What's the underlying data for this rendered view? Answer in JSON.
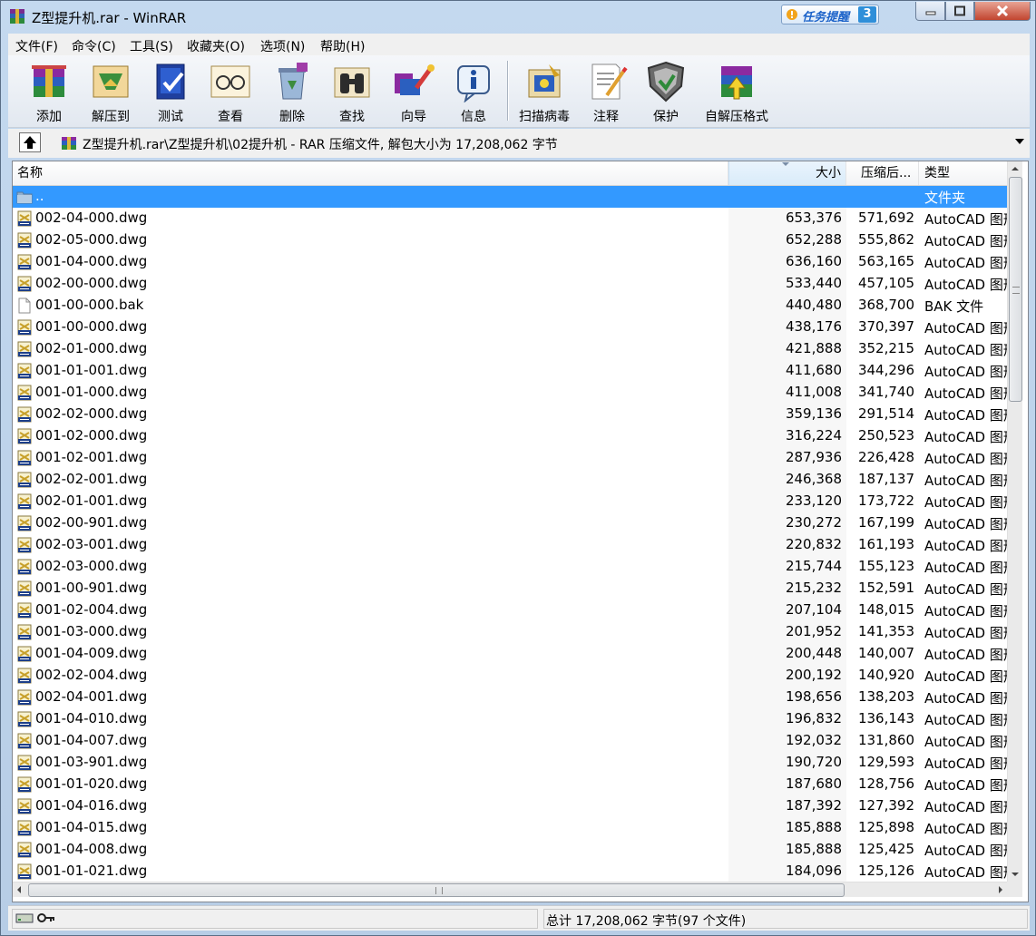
{
  "window": {
    "title": "Z型提升机.rar - WinRAR",
    "tip_text": "任务提醒",
    "tip_count": "3"
  },
  "menu": [
    "文件(F)",
    "命令(C)",
    "工具(S)",
    "收藏夹(O)",
    "选项(N)",
    "帮助(H)"
  ],
  "toolbar": {
    "add": "添加",
    "extract": "解压到",
    "test": "测试",
    "view": "查看",
    "delete": "删除",
    "find": "查找",
    "wizard": "向导",
    "info": "信息",
    "scan": "扫描病毒",
    "comment": "注释",
    "protect": "保护",
    "sfx": "自解压格式"
  },
  "address": {
    "path": "Z型提升机.rar\\Z型提升机\\02提升机 - RAR 压缩文件, 解包大小为 17,208,062 字节"
  },
  "columns": {
    "name": "名称",
    "size": "大小",
    "packed": "压缩后...",
    "type": "类型"
  },
  "files": [
    {
      "name": "..",
      "size": "",
      "packed": "",
      "type": "文件夹",
      "icon": "folder-up-icon"
    },
    {
      "name": "002-04-000.dwg",
      "size": "653,376",
      "packed": "571,692",
      "type": "AutoCAD 图形",
      "icon": "dwg-file-icon"
    },
    {
      "name": "002-05-000.dwg",
      "size": "652,288",
      "packed": "555,862",
      "type": "AutoCAD 图形",
      "icon": "dwg-file-icon"
    },
    {
      "name": "001-04-000.dwg",
      "size": "636,160",
      "packed": "563,165",
      "type": "AutoCAD 图形",
      "icon": "dwg-file-icon"
    },
    {
      "name": "002-00-000.dwg",
      "size": "533,440",
      "packed": "457,105",
      "type": "AutoCAD 图形",
      "icon": "dwg-file-icon"
    },
    {
      "name": "001-00-000.bak",
      "size": "440,480",
      "packed": "368,700",
      "type": "BAK 文件",
      "icon": "blank-file-icon"
    },
    {
      "name": "001-00-000.dwg",
      "size": "438,176",
      "packed": "370,397",
      "type": "AutoCAD 图形",
      "icon": "dwg-file-icon"
    },
    {
      "name": "002-01-000.dwg",
      "size": "421,888",
      "packed": "352,215",
      "type": "AutoCAD 图形",
      "icon": "dwg-file-icon"
    },
    {
      "name": "001-01-001.dwg",
      "size": "411,680",
      "packed": "344,296",
      "type": "AutoCAD 图形",
      "icon": "dwg-file-icon"
    },
    {
      "name": "001-01-000.dwg",
      "size": "411,008",
      "packed": "341,740",
      "type": "AutoCAD 图形",
      "icon": "dwg-file-icon"
    },
    {
      "name": "002-02-000.dwg",
      "size": "359,136",
      "packed": "291,514",
      "type": "AutoCAD 图形",
      "icon": "dwg-file-icon"
    },
    {
      "name": "001-02-000.dwg",
      "size": "316,224",
      "packed": "250,523",
      "type": "AutoCAD 图形",
      "icon": "dwg-file-icon"
    },
    {
      "name": "001-02-001.dwg",
      "size": "287,936",
      "packed": "226,428",
      "type": "AutoCAD 图形",
      "icon": "dwg-file-icon"
    },
    {
      "name": "002-02-001.dwg",
      "size": "246,368",
      "packed": "187,137",
      "type": "AutoCAD 图形",
      "icon": "dwg-file-icon"
    },
    {
      "name": "002-01-001.dwg",
      "size": "233,120",
      "packed": "173,722",
      "type": "AutoCAD 图形",
      "icon": "dwg-file-icon"
    },
    {
      "name": "002-00-901.dwg",
      "size": "230,272",
      "packed": "167,199",
      "type": "AutoCAD 图形",
      "icon": "dwg-file-icon"
    },
    {
      "name": "002-03-001.dwg",
      "size": "220,832",
      "packed": "161,193",
      "type": "AutoCAD 图形",
      "icon": "dwg-file-icon"
    },
    {
      "name": "002-03-000.dwg",
      "size": "215,744",
      "packed": "155,123",
      "type": "AutoCAD 图形",
      "icon": "dwg-file-icon"
    },
    {
      "name": "001-00-901.dwg",
      "size": "215,232",
      "packed": "152,591",
      "type": "AutoCAD 图形",
      "icon": "dwg-file-icon"
    },
    {
      "name": "001-02-004.dwg",
      "size": "207,104",
      "packed": "148,015",
      "type": "AutoCAD 图形",
      "icon": "dwg-file-icon"
    },
    {
      "name": "001-03-000.dwg",
      "size": "201,952",
      "packed": "141,353",
      "type": "AutoCAD 图形",
      "icon": "dwg-file-icon"
    },
    {
      "name": "001-04-009.dwg",
      "size": "200,448",
      "packed": "140,007",
      "type": "AutoCAD 图形",
      "icon": "dwg-file-icon"
    },
    {
      "name": "002-02-004.dwg",
      "size": "200,192",
      "packed": "140,920",
      "type": "AutoCAD 图形",
      "icon": "dwg-file-icon"
    },
    {
      "name": "002-04-001.dwg",
      "size": "198,656",
      "packed": "138,203",
      "type": "AutoCAD 图形",
      "icon": "dwg-file-icon"
    },
    {
      "name": "001-04-010.dwg",
      "size": "196,832",
      "packed": "136,143",
      "type": "AutoCAD 图形",
      "icon": "dwg-file-icon"
    },
    {
      "name": "001-04-007.dwg",
      "size": "192,032",
      "packed": "131,860",
      "type": "AutoCAD 图形",
      "icon": "dwg-file-icon"
    },
    {
      "name": "001-03-901.dwg",
      "size": "190,720",
      "packed": "129,593",
      "type": "AutoCAD 图形",
      "icon": "dwg-file-icon"
    },
    {
      "name": "001-01-020.dwg",
      "size": "187,680",
      "packed": "128,756",
      "type": "AutoCAD 图形",
      "icon": "dwg-file-icon"
    },
    {
      "name": "001-04-016.dwg",
      "size": "187,392",
      "packed": "127,392",
      "type": "AutoCAD 图形",
      "icon": "dwg-file-icon"
    },
    {
      "name": "001-04-015.dwg",
      "size": "185,888",
      "packed": "125,898",
      "type": "AutoCAD 图形",
      "icon": "dwg-file-icon"
    },
    {
      "name": "001-04-008.dwg",
      "size": "185,888",
      "packed": "125,425",
      "type": "AutoCAD 图形",
      "icon": "dwg-file-icon"
    },
    {
      "name": "001-01-021.dwg",
      "size": "184,096",
      "packed": "125,126",
      "type": "AutoCAD 图形",
      "icon": "dwg-file-icon"
    }
  ],
  "status": {
    "summary": "总计 17,208,062 字节(97 个文件)"
  },
  "colors": {
    "selection": "#3399ff",
    "window_frame": "#b9d1ea",
    "close_button": "#c2452f"
  }
}
